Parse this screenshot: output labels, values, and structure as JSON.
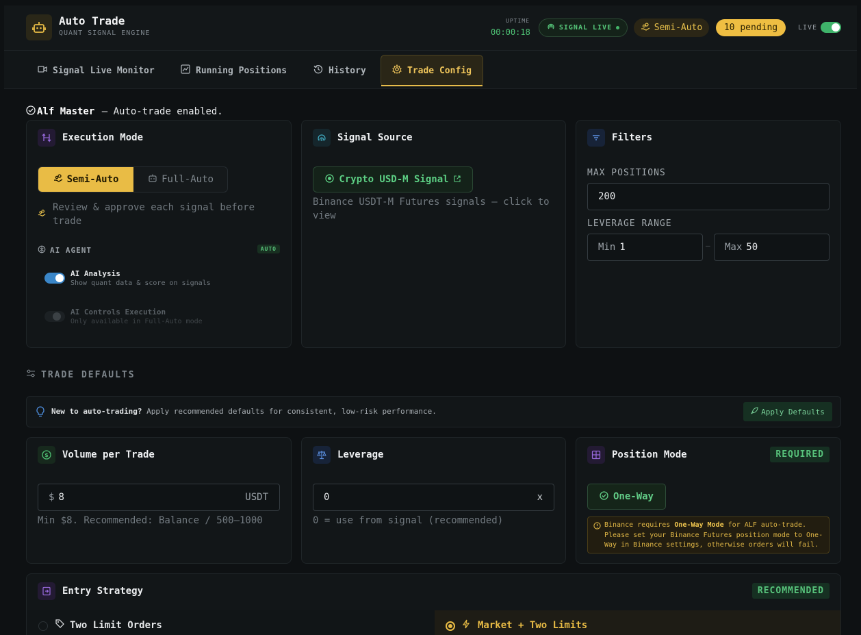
{
  "header": {
    "app_title": "Auto Trade",
    "app_subtitle": "QUANT SIGNAL ENGINE",
    "uptime_label": "UPTIME",
    "uptime_value": "00:00:18",
    "signal_status": "SIGNAL LIVE",
    "mode_label": "Semi-Auto",
    "pending_label": "10 pending",
    "live_label": "LIVE",
    "live_enabled": true
  },
  "tabs": [
    {
      "label": "Signal Live Monitor",
      "icon": "video-icon",
      "active": false
    },
    {
      "label": "Running Positions",
      "icon": "chart-line-icon",
      "active": false
    },
    {
      "label": "History",
      "icon": "history-icon",
      "active": false
    },
    {
      "label": "Trade Config",
      "icon": "gear-icon",
      "active": true
    }
  ],
  "notice": {
    "bold": "Alf Master",
    "text": " — Auto-trade enabled."
  },
  "execution_mode": {
    "title": "Execution Mode",
    "options": [
      "Semi-Auto",
      "Full-Auto"
    ],
    "selected": "Semi-Auto",
    "description": "Review & approve each signal before trade",
    "ai_agent_label": "AI AGENT",
    "ai_agent_badge": "AUTO",
    "ai_analysis": {
      "title": "AI Analysis",
      "desc": "Show quant data & score on signals",
      "enabled": true
    },
    "ai_controls": {
      "title": "AI Controls Execution",
      "desc": "Only available in Full-Auto mode",
      "enabled": false
    }
  },
  "signal_source": {
    "title": "Signal Source",
    "button_label": "Crypto USD-M Signal",
    "description": "Binance USDT-M Futures signals — click to view"
  },
  "filters": {
    "title": "Filters",
    "max_positions_label": "MAX POSITIONS",
    "max_positions_value": "200",
    "leverage_range_label": "LEVERAGE RANGE",
    "min_prefix": "Min",
    "min_value": "1",
    "separator": "–",
    "max_prefix": "Max",
    "max_value": "50"
  },
  "trade_defaults": {
    "section_title": "TRADE DEFAULTS",
    "tip_bold": "New to auto-trading?",
    "tip_text": " Apply recommended defaults for consistent, low-risk performance.",
    "apply_label": "Apply Defaults"
  },
  "volume": {
    "title": "Volume per Trade",
    "prefix": "$",
    "value": "8",
    "suffix": "USDT",
    "hint": "Min $8. Recommended: Balance / 500–1000"
  },
  "leverage": {
    "title": "Leverage",
    "value": "0",
    "suffix": "x",
    "hint": "0 = use from signal (recommended)"
  },
  "position_mode": {
    "title": "Position Mode",
    "badge": "REQUIRED",
    "option": "One-Way",
    "warn_pre": "Binance requires ",
    "warn_bold": "One-Way Mode",
    "warn_post": " for ALF auto-trade. Please set your Binance Futures position mode to One-Way in Binance settings, otherwise orders will fail."
  },
  "entry_strategy": {
    "title": "Entry Strategy",
    "badge": "RECOMMENDED",
    "options": [
      {
        "label": "Two Limit Orders",
        "selected": false
      },
      {
        "label": "Market + Two Limits",
        "selected": true
      }
    ]
  },
  "colors": {
    "accent": "#e9bc45",
    "green": "#57c97b",
    "toggle_on": "#3a86c8",
    "background": "#0e1113"
  }
}
